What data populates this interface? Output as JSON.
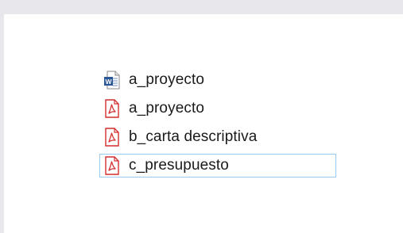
{
  "files": [
    {
      "name": "a_proyecto",
      "type": "word",
      "icon": "word-document-icon",
      "selected": false
    },
    {
      "name": "a_proyecto",
      "type": "pdf",
      "icon": "pdf-document-icon",
      "selected": false
    },
    {
      "name": "b_carta descriptiva",
      "type": "pdf",
      "icon": "pdf-document-icon",
      "selected": false
    },
    {
      "name": "c_presupuesto",
      "type": "pdf",
      "icon": "pdf-document-icon",
      "selected": true
    }
  ],
  "colors": {
    "background": "#e8e8ec",
    "panel": "#ffffff",
    "selection_border": "#99c9ef",
    "word_blue": "#2b5797",
    "pdf_red": "#d32f2f"
  }
}
